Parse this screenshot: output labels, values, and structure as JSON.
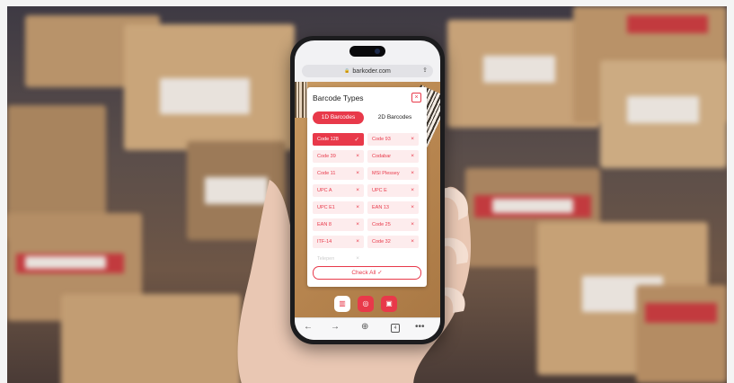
{
  "browser": {
    "url": "barkoder.com",
    "tab_count": "4"
  },
  "panel": {
    "title": "Barcode Types",
    "tabs": [
      {
        "label": "1D Barcodes",
        "active": true
      },
      {
        "label": "2D Barcodes",
        "active": false
      }
    ],
    "items": [
      {
        "label": "Code 128",
        "selected": true
      },
      {
        "label": "Code 93",
        "selected": false
      },
      {
        "label": "Code 39",
        "selected": false
      },
      {
        "label": "Codabar",
        "selected": false
      },
      {
        "label": "Code 11",
        "selected": false
      },
      {
        "label": "MSI Plessey",
        "selected": false
      },
      {
        "label": "UPC A",
        "selected": false
      },
      {
        "label": "UPC E",
        "selected": false
      },
      {
        "label": "UPC E1",
        "selected": false
      },
      {
        "label": "EAN 13",
        "selected": false
      },
      {
        "label": "EAN 8",
        "selected": false
      },
      {
        "label": "Code 25",
        "selected": false
      },
      {
        "label": "ITF-14",
        "selected": false
      },
      {
        "label": "Code 32",
        "selected": false
      },
      {
        "label": "Telepen",
        "selected": false
      }
    ],
    "check_all_label": "Check All"
  },
  "colors": {
    "accent": "#e8394a",
    "item_bg": "#fdeced"
  },
  "icons": {
    "selected": "check-icon",
    "unselected": "close-icon"
  }
}
